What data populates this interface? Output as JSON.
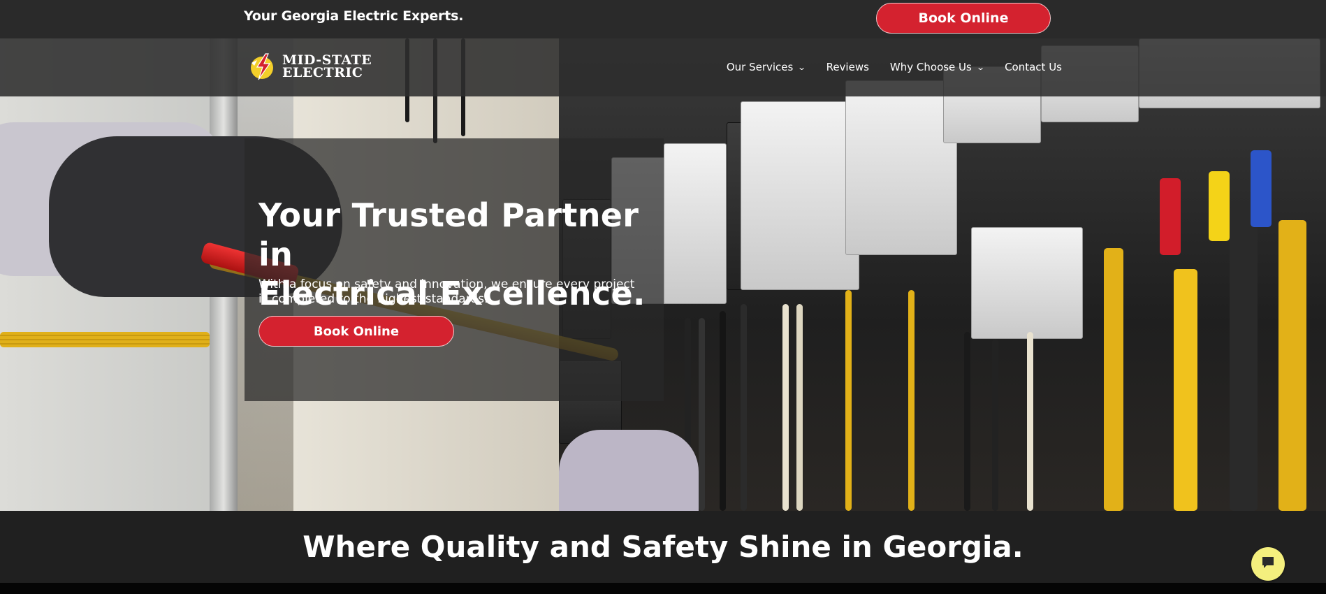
{
  "topbar": {
    "tagline": "Your Georgia Electric Experts.",
    "book_label": "Book Online"
  },
  "logo": {
    "line1": "MID-STATE",
    "line2": "ELECTRIC"
  },
  "nav": {
    "items": [
      {
        "label": "Our Services",
        "has_dropdown": true
      },
      {
        "label": "Reviews",
        "has_dropdown": false
      },
      {
        "label": "Why Choose Us",
        "has_dropdown": true
      },
      {
        "label": "Contact Us",
        "has_dropdown": false
      }
    ]
  },
  "hero": {
    "title_line1": "Your Trusted Partner in",
    "title_line2": "Electrical Excellence.",
    "subtitle_line1": "With a focus on safety and innovation, we ensure every project",
    "subtitle_line2": "is completed to the highest standards.",
    "book_label": "Book Online"
  },
  "banner": {
    "title": "Where Quality and Safety Shine in Georgia."
  },
  "icons": {
    "chat": "chat-bubble-icon",
    "chevron": "chevron-down-icon",
    "logo": "lightning-bolt-icon"
  },
  "colors": {
    "accent": "#d4222f",
    "topbar": "#2a2a2a",
    "chat_button": "#f4ef7e"
  }
}
